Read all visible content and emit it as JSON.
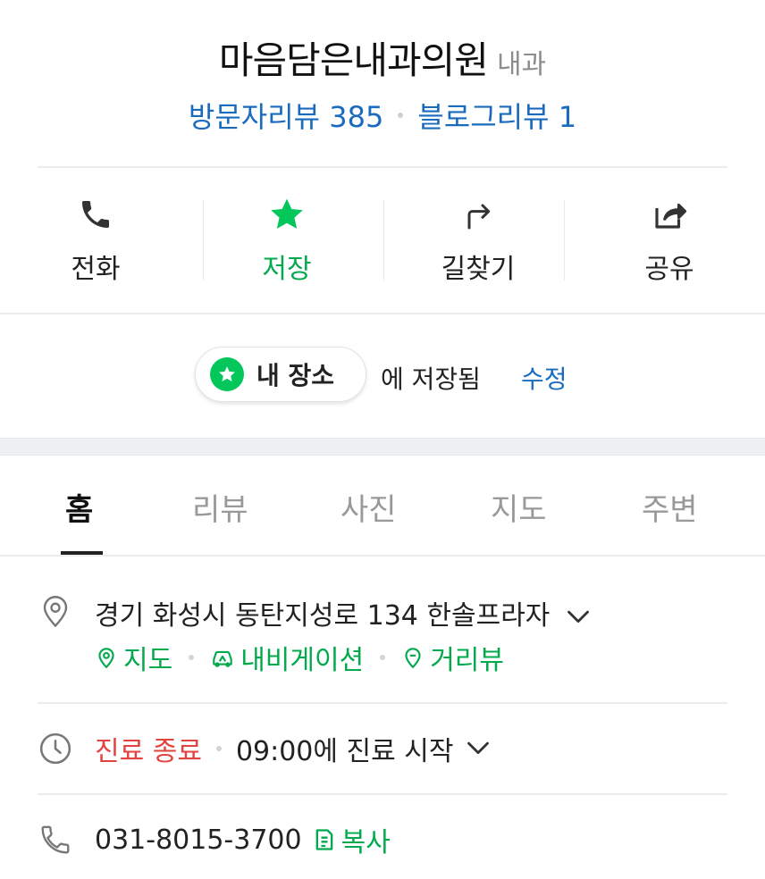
{
  "place": {
    "name": "마음담은내과의원",
    "category": "내과",
    "visitor_reviews": "방문자리뷰 385",
    "blog_reviews": "블로그리뷰 1"
  },
  "actions": [
    {
      "label": "전화",
      "icon": "phone-icon"
    },
    {
      "label": "저장",
      "icon": "star-icon",
      "active_color": "#03a94d"
    },
    {
      "label": "길찾기",
      "icon": "directions-icon"
    },
    {
      "label": "공유",
      "icon": "share-icon"
    }
  ],
  "saved": {
    "folder_name": "내 장소",
    "suffix": "에 저장됨",
    "edit_label": "수정"
  },
  "tabs": [
    {
      "label": "홈",
      "active": true
    },
    {
      "label": "리뷰",
      "active": false
    },
    {
      "label": "사진",
      "active": false
    },
    {
      "label": "지도",
      "active": false
    },
    {
      "label": "주변",
      "active": false
    }
  ],
  "address": {
    "text": "경기 화성시 동탄지성로 134 한솔프라자",
    "links": [
      "지도",
      "내비게이션",
      "거리뷰"
    ]
  },
  "hours": {
    "status": "진료 종료",
    "next": "09:00에 진료 시작"
  },
  "phone": {
    "number": "031-8015-3700",
    "copy_label": "복사"
  },
  "colors": {
    "accent_green": "#03a94d",
    "link_blue": "#1a6bbd",
    "closed_red": "#e2433e"
  }
}
